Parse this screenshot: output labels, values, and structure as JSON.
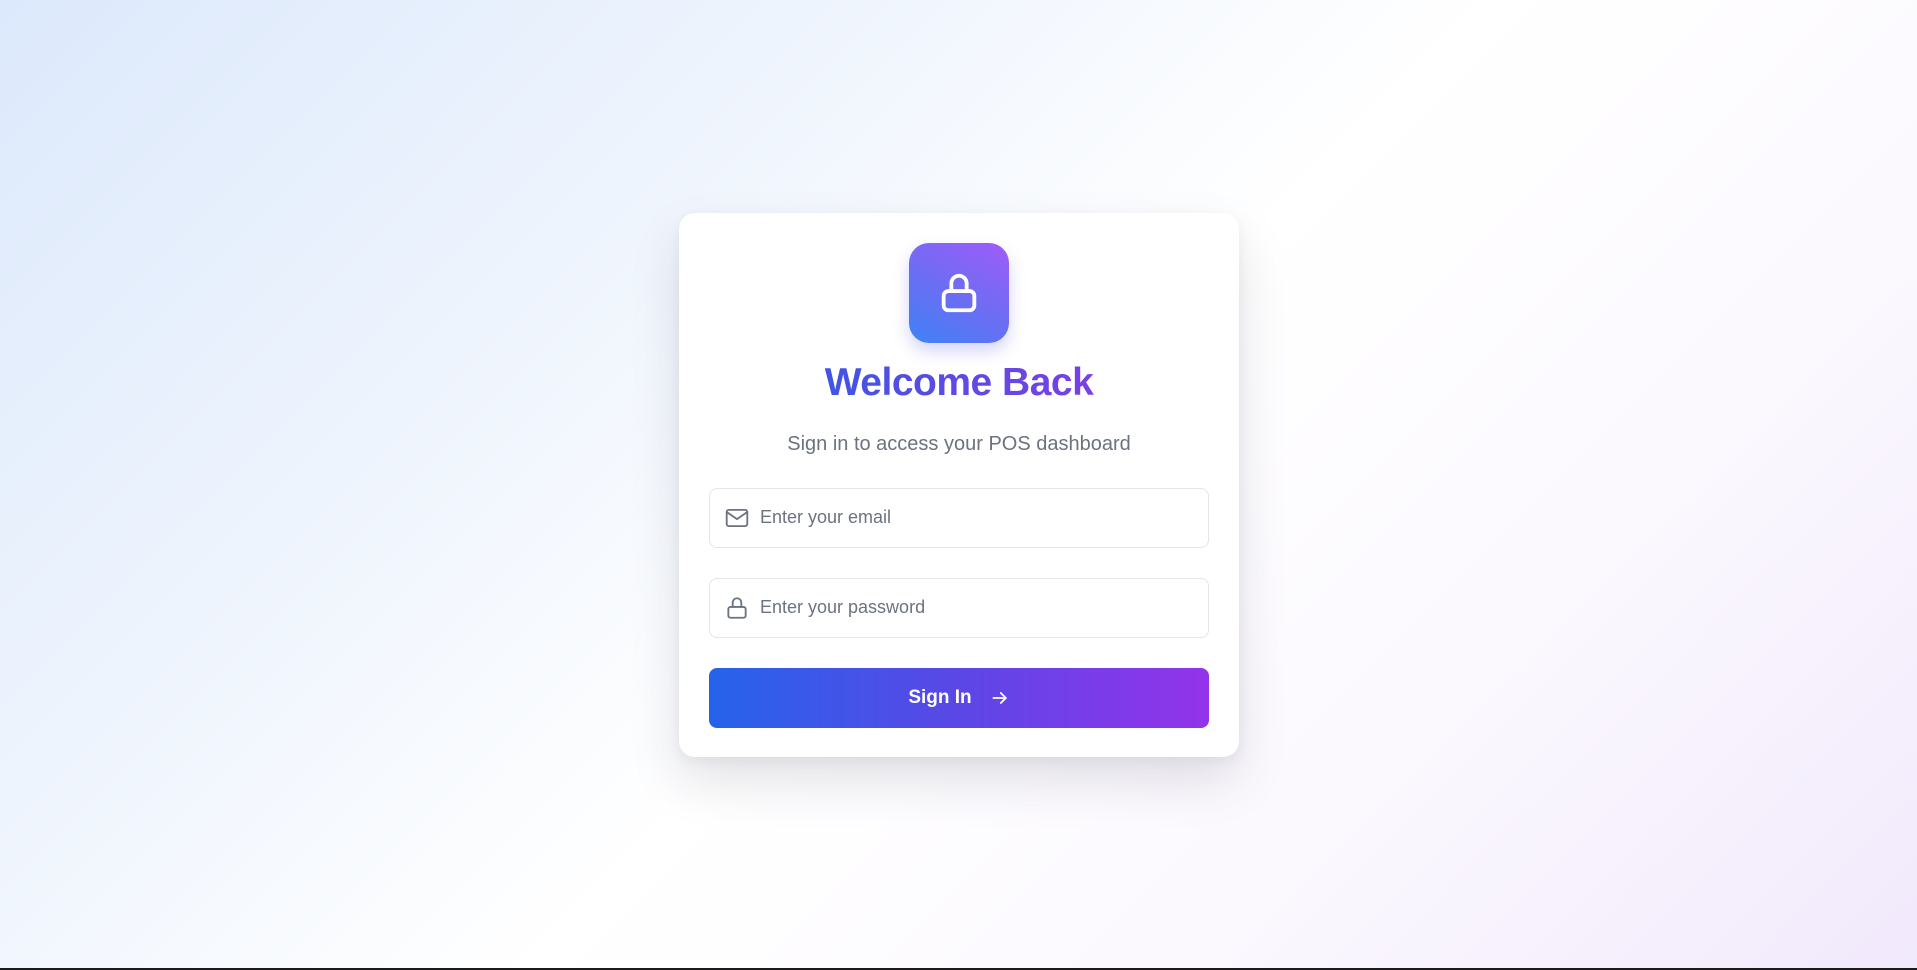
{
  "login": {
    "title": "Welcome Back",
    "subtitle": "Sign in to access your POS dashboard",
    "logo_icon": "lock-icon",
    "email": {
      "icon": "mail-icon",
      "placeholder": "Enter your email",
      "value": ""
    },
    "password": {
      "icon": "lock-icon",
      "placeholder": "Enter your password",
      "value": ""
    },
    "submit": {
      "label": "Sign In",
      "icon": "arrow-right-icon"
    }
  },
  "colors": {
    "accent_blue": "#2563eb",
    "accent_purple": "#9333ea",
    "title": "#4f46e5",
    "muted_text": "#6b7280"
  }
}
